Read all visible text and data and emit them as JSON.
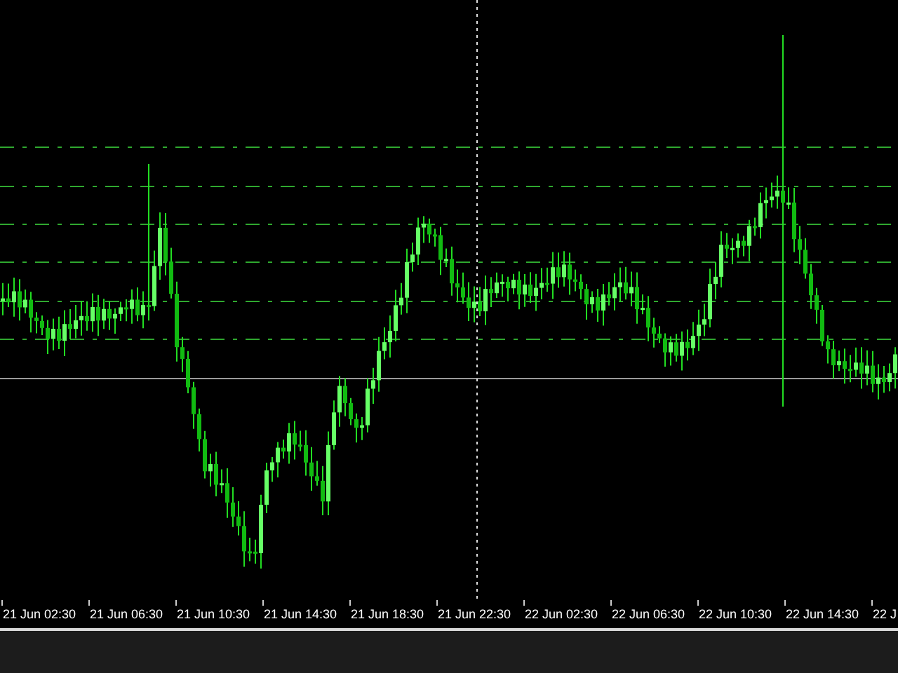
{
  "time_axis": {
    "labels": [
      "21 Jun 02:30",
      "21 Jun 06:30",
      "21 Jun 10:30",
      "21 Jun 14:30",
      "21 Jun 18:30",
      "21 Jun 22:30",
      "22 Jun 02:30",
      "22 Jun 06:30",
      "22 Jun 10:30",
      "22 Jun 14:30",
      "22 J"
    ]
  }
}
